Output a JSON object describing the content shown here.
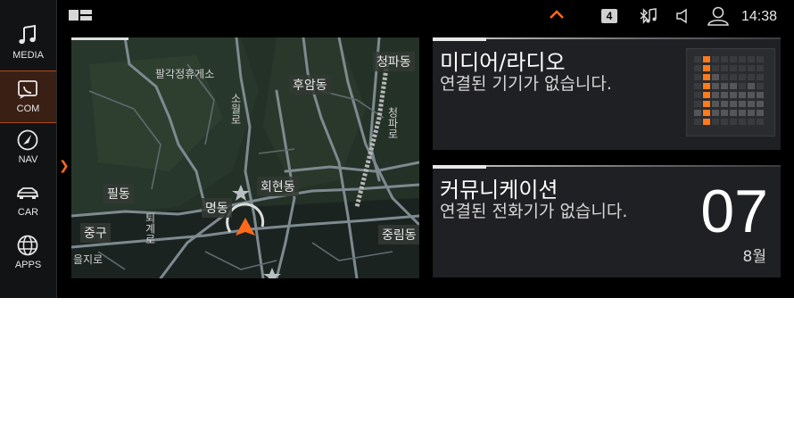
{
  "sidebar": {
    "items": [
      {
        "label": "MEDIA",
        "icon": "music-note-icon"
      },
      {
        "label": "COM",
        "icon": "phone-icon"
      },
      {
        "label": "NAV",
        "icon": "navigation-icon"
      },
      {
        "label": "CAR",
        "icon": "car-icon"
      },
      {
        "label": "APPS",
        "icon": "globe-icon"
      }
    ],
    "active_index": 1
  },
  "status_bar": {
    "sim_indicator": "4",
    "time": "14:38"
  },
  "map": {
    "labels": [
      "팔각정휴게소",
      "청파동",
      "후암동",
      "회현동",
      "필동",
      "명동",
      "중구",
      "중림동",
      "을지로",
      "퇴계로",
      "청파로",
      "소월로"
    ]
  },
  "media_panel": {
    "title": "미디어/라디오",
    "subtitle": "연결된 기기가 없습니다."
  },
  "com_panel": {
    "title": "커뮤니케이션",
    "subtitle": "연결된 전화기가 없습니다.",
    "day": "07",
    "month": "8월"
  },
  "colors": {
    "accent": "#ff6a1a",
    "panel_bg": "#1f2023",
    "map_bg": "#1f2a22",
    "road": "#7f8a90"
  }
}
